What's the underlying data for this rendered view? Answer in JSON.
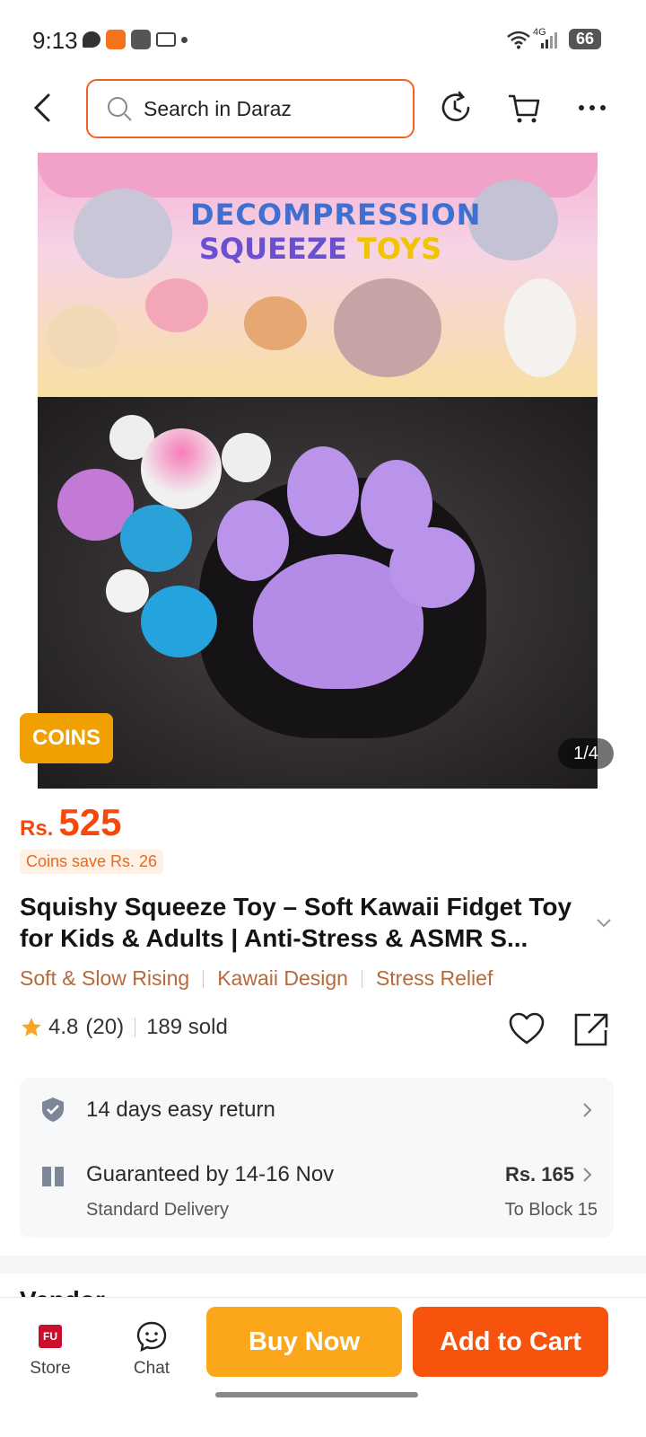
{
  "status_bar": {
    "time": "9:13",
    "network": "4G",
    "battery": "66"
  },
  "header": {
    "search_placeholder": "Search in Daraz"
  },
  "gallery": {
    "package_title_line1": "DECOMPRESSION",
    "package_title_line2a": "SQUEEZE",
    "package_title_line2b": "TOYS",
    "coins_badge": "COINS",
    "counter": "1/4"
  },
  "product": {
    "currency": "Rs.",
    "price": "525",
    "coins_save": "Coins save Rs. 26",
    "title": "Squishy Squeeze Toy – Soft Kawaii Fidget Toy for Kids & Adults | Anti-Stress & ASMR S...",
    "tags": [
      "Soft & Slow Rising",
      "Kawaii Design",
      "Stress Relief"
    ],
    "rating": "4.8",
    "rating_count": "(20)",
    "sold": "189 sold"
  },
  "services": {
    "return_text": "14 days easy return",
    "delivery_text": "Guaranteed by 14-16 Nov",
    "delivery_type": "Standard Delivery",
    "delivery_price": "Rs. 165",
    "delivery_dest": "To Block 15"
  },
  "section_peek": "Vendor",
  "bottom_bar": {
    "store_label": "Store",
    "chat_label": "Chat",
    "buy_now": "Buy Now",
    "add_to_cart": "Add to Cart"
  },
  "colors": {
    "accent": "#f5480a",
    "buy_now": "#fca61c",
    "add_to_cart": "#f7530c",
    "coins_badge": "#f0a000",
    "tag_text": "#b8683a"
  }
}
